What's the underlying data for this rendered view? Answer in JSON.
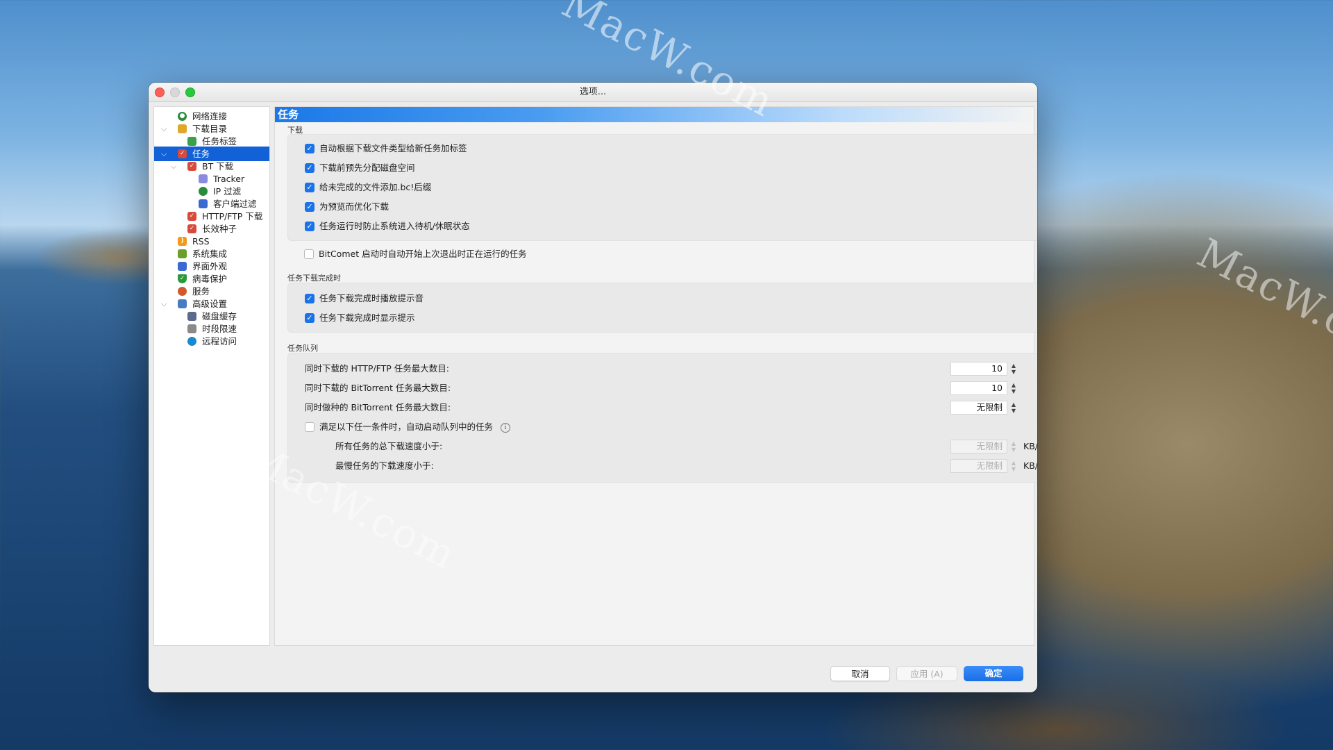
{
  "window": {
    "title": "选项..."
  },
  "sidebar": {
    "items": [
      {
        "label": "网络连接",
        "icon": "globe-icon",
        "color": "#2a8c3a"
      },
      {
        "label": "下载目录",
        "icon": "folder-icon",
        "color": "#e0a82a",
        "expanded": true
      },
      {
        "label": "任务标签",
        "icon": "tag-icon",
        "color": "#3aa04a"
      },
      {
        "label": "任务",
        "icon": "task-icon",
        "color": "#d94a3a",
        "selected": true,
        "expanded": true
      },
      {
        "label": "BT 下载",
        "icon": "bt-task-icon",
        "color": "#d94a3a",
        "expanded": true
      },
      {
        "label": "Tracker",
        "icon": "tracker-icon",
        "color": "#8a8ae0"
      },
      {
        "label": "IP 过滤",
        "icon": "ip-filter-icon",
        "color": "#2a8c3a"
      },
      {
        "label": "客户端过滤",
        "icon": "client-filter-icon",
        "color": "#3a6ad0"
      },
      {
        "label": "HTTP/FTP 下载",
        "icon": "http-task-icon",
        "color": "#d94a3a"
      },
      {
        "label": "长效种子",
        "icon": "long-seed-icon",
        "color": "#d94a3a"
      },
      {
        "label": "RSS",
        "icon": "rss-icon",
        "color": "#f29a1a"
      },
      {
        "label": "系统集成",
        "icon": "integration-icon",
        "color": "#6aa02a"
      },
      {
        "label": "界面外观",
        "icon": "appearance-icon",
        "color": "#3a6ad0"
      },
      {
        "label": "病毒保护",
        "icon": "shield-icon",
        "color": "#2a9a3a"
      },
      {
        "label": "服务",
        "icon": "service-icon",
        "color": "#d05a2a"
      },
      {
        "label": "高级设置",
        "icon": "advanced-icon",
        "color": "#4a7ac0",
        "expanded": true
      },
      {
        "label": "磁盘缓存",
        "icon": "disk-cache-icon",
        "color": "#5a6a8a"
      },
      {
        "label": "时段限速",
        "icon": "schedule-icon",
        "color": "#8a8a8a"
      },
      {
        "label": "远程访问",
        "icon": "remote-icon",
        "color": "#1a8ad0"
      }
    ]
  },
  "panel": {
    "title": "任务",
    "download_section": {
      "label": "下载",
      "options": [
        {
          "label": "自动根据下载文件类型给新任务加标签",
          "checked": true
        },
        {
          "label": "下载前预先分配磁盘空间",
          "checked": true
        },
        {
          "label": "给未完成的文件添加.bc!后缀",
          "checked": true
        },
        {
          "label": "为预览而优化下载",
          "checked": true
        },
        {
          "label": "任务运行时防止系统进入待机/休眠状态",
          "checked": true
        },
        {
          "label": "BitComet 启动时自动开始上次退出时正在运行的任务",
          "checked": false
        }
      ]
    },
    "complete_section": {
      "label": "任务下载完成时",
      "options": [
        {
          "label": "任务下载完成时播放提示音",
          "checked": true
        },
        {
          "label": "任务下载完成时显示提示",
          "checked": true
        }
      ]
    },
    "queue_section": {
      "label": "任务队列",
      "max_http_label": "同时下载的 HTTP/FTP 任务最大数目:",
      "max_http_value": "10",
      "max_bt_label": "同时下载的 BitTorrent 任务最大数目:",
      "max_bt_value": "10",
      "max_seed_label": "同时做种的 BitTorrent 任务最大数目:",
      "max_seed_value": "无限制",
      "auto_start_label": "满足以下任一条件时，自动启动队列中的任务",
      "auto_start_checked": false,
      "total_speed_label": "所有任务的总下载速度小于:",
      "total_speed_value": "无限制",
      "slowest_speed_label": "最慢任务的下载速度小于:",
      "slowest_speed_value": "无限制",
      "unit": "KB/s"
    }
  },
  "buttons": {
    "cancel": "取消",
    "apply": "应用 (A)",
    "ok": "确定"
  },
  "watermarks": [
    "MacW.com",
    "MacW.c",
    "MacW.com"
  ]
}
